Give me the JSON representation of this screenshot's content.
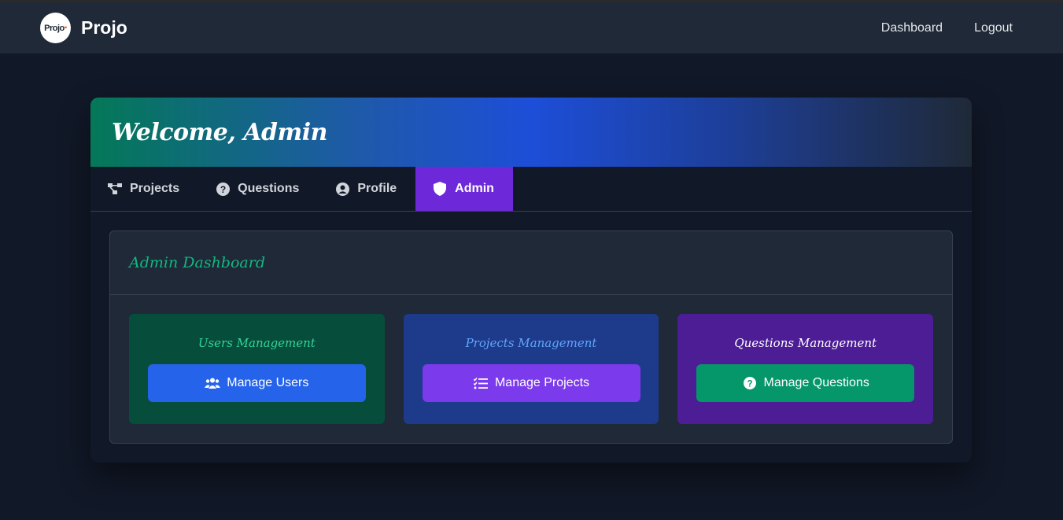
{
  "header": {
    "logo_text": "Projo",
    "brand_name": "Projo",
    "nav": [
      "Dashboard",
      "Logout"
    ]
  },
  "hero": {
    "title": "Welcome, Admin"
  },
  "tabs": [
    {
      "label": "Projects",
      "icon": "project-diagram-icon",
      "active": false
    },
    {
      "label": "Questions",
      "icon": "question-circle-icon",
      "active": false
    },
    {
      "label": "Profile",
      "icon": "user-circle-icon",
      "active": false
    },
    {
      "label": "Admin",
      "icon": "shield-icon",
      "active": true
    }
  ],
  "panel": {
    "title": "Admin Dashboard",
    "cards": [
      {
        "title": "Users Management",
        "button": "Manage Users",
        "icon": "users-icon"
      },
      {
        "title": "Projects Management",
        "button": "Manage Projects",
        "icon": "tasks-icon"
      },
      {
        "title": "Questions Management",
        "button": "Manage Questions",
        "icon": "question-circle-icon"
      }
    ]
  },
  "colors": {
    "background": "#111827",
    "active_tab": "#6d28d9",
    "accent_green": "#10b981",
    "btn_blue": "#2563eb",
    "btn_purple": "#7c3aed",
    "btn_green": "#059669"
  }
}
